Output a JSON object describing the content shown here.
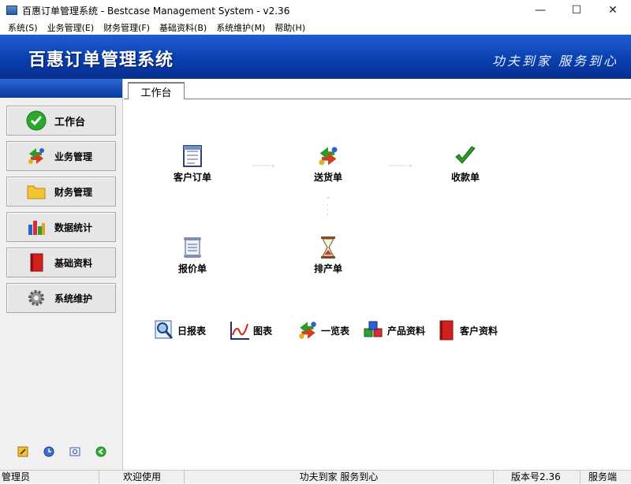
{
  "window": {
    "title": "百惠订单管理系统 - Bestcase Management System - v2.36",
    "controls": {
      "minimize": "—",
      "maximize": "☐",
      "close": "✕"
    }
  },
  "menu": [
    "系统(S)",
    "业务管理(E)",
    "财务管理(F)",
    "基础资料(B)",
    "系统维护(M)",
    "帮助(H)"
  ],
  "banner": {
    "brand": "百惠订单管理系统",
    "slogan": "功夫到家 服务到心"
  },
  "nav": [
    {
      "label": "工作台",
      "icon": "check-circle-icon",
      "active": true
    },
    {
      "label": "业务管理",
      "icon": "recycle-arrows-icon"
    },
    {
      "label": "财务管理",
      "icon": "folder-icon"
    },
    {
      "label": "数据统计",
      "icon": "bar-chart-icon"
    },
    {
      "label": "基础资料",
      "icon": "red-book-icon"
    },
    {
      "label": "系统维护",
      "icon": "gear-icon"
    }
  ],
  "bottom_icons": [
    "edit-icon",
    "clock-icon",
    "search-window-icon",
    "green-arrow-icon"
  ],
  "tab": {
    "label": "工作台"
  },
  "workflow": {
    "customer_order": "客户订单",
    "delivery": "送货单",
    "receipt": "收款单",
    "quotation": "报价单",
    "production": "排产单"
  },
  "quick_links": [
    "日报表",
    "图表",
    "一览表",
    "产品资料",
    "客户资料"
  ],
  "status": {
    "user": "管理员",
    "welcome": "欢迎使用",
    "slogan": "功夫到家 服务到心",
    "version": "版本号2.36",
    "side": "服务端"
  },
  "colors": {
    "banner": "#0a3fb0",
    "accent_green": "#2aa82a"
  }
}
